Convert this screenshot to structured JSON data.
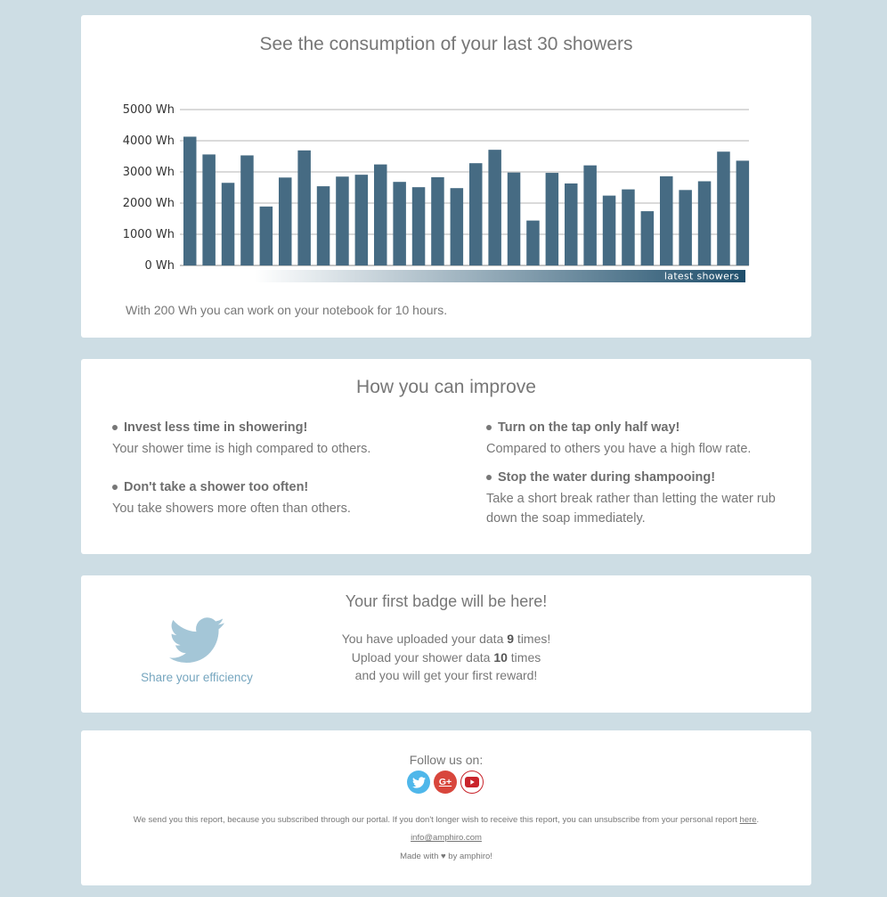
{
  "chart_section": {
    "title": "See the consumption of your last 30 showers",
    "note": "With 200 Wh you can work on your notebook for 10 hours.",
    "gradient_label": "latest showers"
  },
  "chart_data": {
    "type": "bar",
    "title": "See the consumption of your last 30 showers",
    "ylabel": "",
    "xlabel": "",
    "unit": "Wh",
    "ylim": [
      0,
      5000
    ],
    "yticks": [
      0,
      1000,
      2000,
      3000,
      4000,
      5000
    ],
    "ytick_labels": [
      "0 Wh",
      "1000 Wh",
      "2000 Wh",
      "3000 Wh",
      "4000 Wh",
      "5000 Wh"
    ],
    "grid": true,
    "bar_color": "#466b83",
    "values": [
      4130,
      3560,
      2650,
      3530,
      1890,
      2820,
      3690,
      2540,
      2850,
      2910,
      3240,
      2680,
      2510,
      2830,
      2480,
      3280,
      3710,
      2980,
      1440,
      2970,
      2630,
      3210,
      2240,
      2440,
      1740,
      2860,
      2420,
      2700,
      3650,
      3360
    ]
  },
  "improve_section": {
    "title": "How you can improve",
    "tips": [
      {
        "head": "Invest less time in showering!",
        "text": "Your shower time is high compared to others."
      },
      {
        "head": "Don't take a shower too often!",
        "text": "You take showers more often than others."
      },
      {
        "head": "Turn on the tap only half way!",
        "text": "Compared to others you have a high flow rate."
      },
      {
        "head": "Stop the water during shampooing!",
        "text": "Take a short break rather than letting the water rub down the soap immediately."
      }
    ]
  },
  "badge_section": {
    "title": "Your first badge will be here!",
    "share_label": "Share your efficiency",
    "line1_pre": "You have uploaded your data ",
    "uploads": "9",
    "line1_post": " times!",
    "line2_pre": "Upload your shower data ",
    "target": "10",
    "line2_post": " times",
    "line3": "and you will get your first reward!"
  },
  "footer": {
    "follow_label": "Follow us on:",
    "social": [
      "twitter-icon",
      "google-plus-icon",
      "youtube-icon"
    ],
    "google_plus_glyph": "G+",
    "unsubscribe_text": "We send you this report, because you subscribed through our portal. If you don't longer wish to receive this report, you can unsubscribe from your personal report ",
    "unsubscribe_link": "here",
    "unsubscribe_end": ".",
    "email": "info@amphiro.com",
    "made_pre": "Made with ",
    "heart": "♥",
    "made_post": " by amphiro!"
  },
  "colors": {
    "background": "#cddde4",
    "bar": "#466b83",
    "accent": "#76a6bf",
    "twitter": "#4fb7ea",
    "google_plus": "#d8463c",
    "youtube": "#c9242b"
  }
}
